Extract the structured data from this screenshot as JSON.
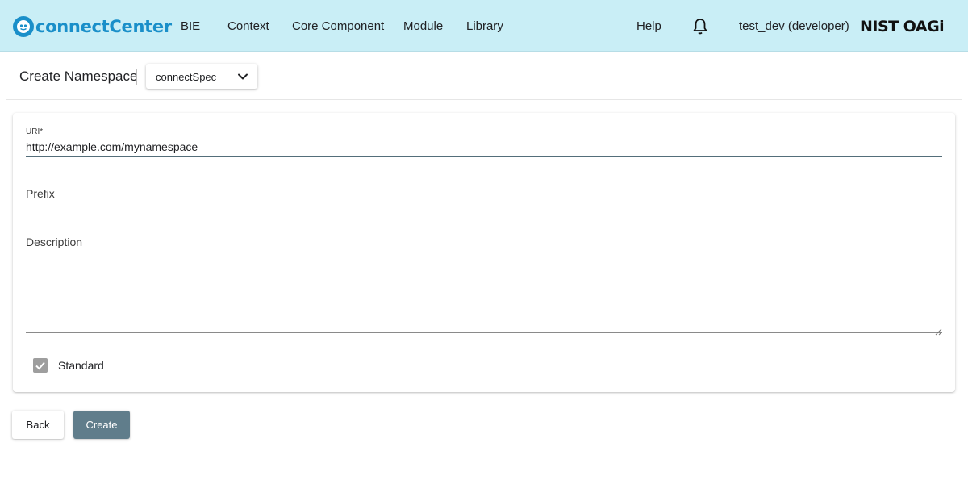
{
  "app": {
    "logo_text": "connectCenter",
    "nav": [
      "BIE",
      "Context",
      "Core Component",
      "Module",
      "Library"
    ],
    "help_label": "Help",
    "user_label": "test_dev (developer)",
    "org_logos_text": "NIST OAGi",
    "topbar_color": "#c9eef6",
    "brand_color": "#1a8fc9"
  },
  "page": {
    "title": "Create Namespace",
    "release_selected": "connectSpec"
  },
  "form": {
    "uri_label": "URI*",
    "uri_value": "http://example.com/mynamespace",
    "prefix_placeholder": "Prefix",
    "prefix_value": "",
    "description_placeholder": "Description",
    "description_value": "",
    "standard_label": "Standard",
    "standard_checked": true
  },
  "actions": {
    "back_label": "Back",
    "create_label": "Create",
    "create_color": "#607d8b"
  },
  "icons": {
    "bell": "bell-icon",
    "dropdown": "chevron-down-icon",
    "checkbox": "check-icon",
    "logo": "connectcenter-logo-icon"
  }
}
